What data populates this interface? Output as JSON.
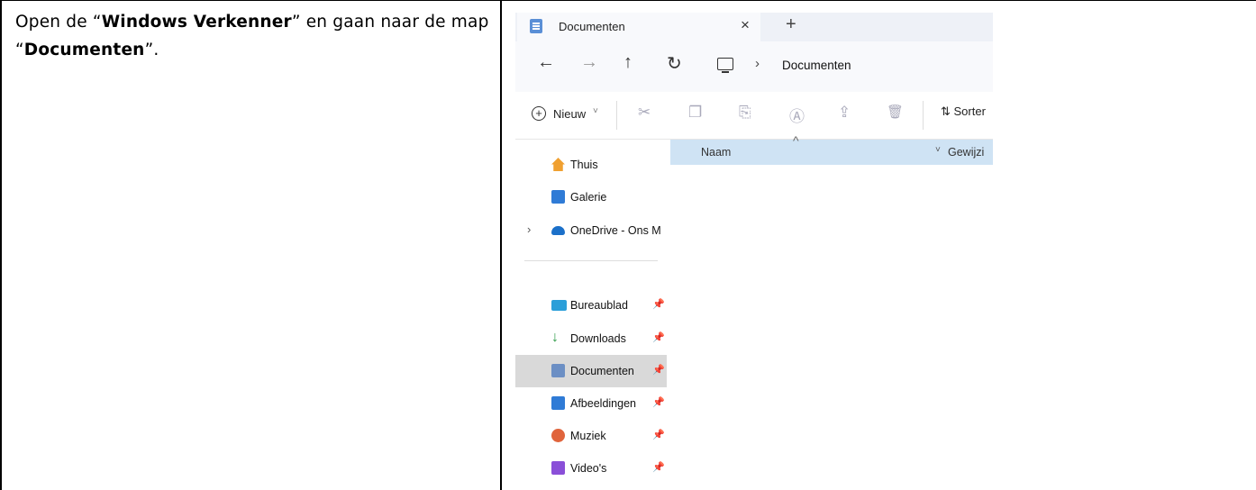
{
  "instruction": {
    "part1": "Open de “",
    "bold1": "Windows Verkenner",
    "part2": "” en gaan naar de map “",
    "bold2": "Documenten",
    "part3": "”."
  },
  "explorer": {
    "tab": {
      "title": "Documenten",
      "close_icon": "×",
      "add_icon": "+"
    },
    "nav": {
      "back_icon": "←",
      "forward_icon": "→",
      "up_icon": "↑",
      "refresh_icon": "↻",
      "separator": "›",
      "breadcrumb": "Documenten"
    },
    "toolbar": {
      "new_label": "Nieuw",
      "new_plus": "+",
      "new_chevron": "˅",
      "icons": [
        "cut-icon",
        "copy-icon",
        "paste-icon",
        "rename-icon",
        "share-icon",
        "delete-icon"
      ],
      "cut_glyph": "✂",
      "copy_glyph": "❐",
      "paste_glyph": "⎘",
      "rename_glyph": "Ⓐ",
      "share_glyph": "⇪",
      "delete_glyph": "🗑",
      "sort_label": "⇅ Sorter"
    },
    "sidebar": {
      "expander": "›",
      "pin_glyph": "📌",
      "items": [
        {
          "label": "Thuis",
          "icon": "home-icon",
          "color": "#f0a030"
        },
        {
          "label": "Galerie",
          "icon": "gallery-icon",
          "color": "#2f7bd6"
        },
        {
          "label": "OneDrive - Ons M",
          "icon": "onedrive-icon",
          "color": "#1b70c9"
        },
        {
          "label": "Bureaublad",
          "icon": "desktop-icon",
          "color": "#2b9fd9"
        },
        {
          "label": "Downloads",
          "icon": "download-icon",
          "color": "#2e9b48"
        },
        {
          "label": "Documenten",
          "icon": "documents-icon",
          "color": "#6c8fc4"
        },
        {
          "label": "Afbeeldingen",
          "icon": "pictures-icon",
          "color": "#2f7bd6"
        },
        {
          "label": "Muziek",
          "icon": "music-icon",
          "color": "#e0643c"
        },
        {
          "label": "Video's",
          "icon": "videos-icon",
          "color": "#8a4fd8"
        }
      ]
    },
    "columns": {
      "name": "Naam",
      "modified": "Gewijzi",
      "sort_caret": "^",
      "chevron": "˅"
    }
  }
}
